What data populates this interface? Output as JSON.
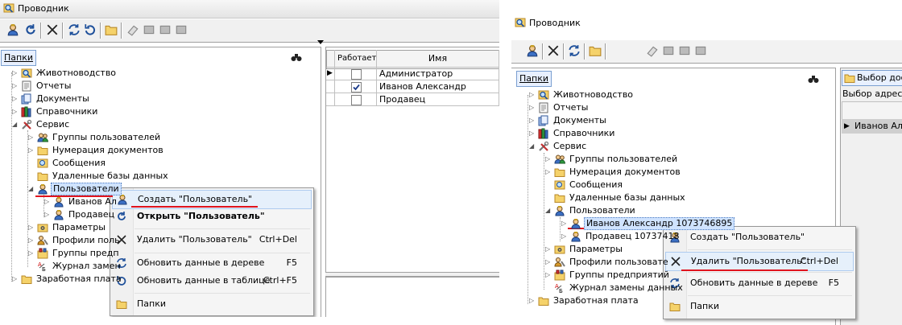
{
  "left_window": {
    "title": "Проводник",
    "folders_tab": "Папки",
    "tree": [
      {
        "label": "Животноводство",
        "icon": "search-folder-icon"
      },
      {
        "label": "Отчеты",
        "icon": "report-icon"
      },
      {
        "label": "Документы",
        "icon": "documents-icon"
      },
      {
        "label": "Справочники",
        "icon": "books-icon"
      },
      {
        "label": "Сервис",
        "icon": "tools-icon"
      },
      {
        "label": "Группы пользователей",
        "icon": "user-group-icon"
      },
      {
        "label": "Нумерация документов",
        "icon": "folder-icon"
      },
      {
        "label": "Сообщения",
        "icon": "messages-icon"
      },
      {
        "label": "Удаленные базы данных",
        "icon": "folder-icon"
      },
      {
        "label": "Пользователи",
        "icon": "users-icon"
      },
      {
        "label": "Иванов Ал",
        "icon": "user-icon"
      },
      {
        "label": "Продавец",
        "icon": "user-icon"
      },
      {
        "label": "Параметры",
        "icon": "params-icon"
      },
      {
        "label": "Профили поль",
        "icon": "profiles-icon"
      },
      {
        "label": "Группы предп",
        "icon": "enterprise-group-icon"
      },
      {
        "label": "Журнал замен",
        "icon": "journal-icon"
      },
      {
        "label": "Заработная плата",
        "icon": "folder-icon"
      }
    ],
    "grid": {
      "columns": [
        "Работает",
        "Имя"
      ],
      "rows": [
        {
          "works": false,
          "name": "Администратор"
        },
        {
          "works": true,
          "name": "Иванов Александр"
        },
        {
          "works": false,
          "name": "Продавец"
        }
      ]
    },
    "menu": [
      {
        "label": "Создать \"Пользователь\"",
        "shortcut": "",
        "icon": "user-create-icon"
      },
      {
        "label": "Открыть \"Пользователь\"",
        "shortcut": "",
        "icon": "refresh-open-icon"
      },
      {
        "label": "Удалить \"Пользователь\"",
        "shortcut": "Ctrl+Del",
        "icon": "delete-x-icon"
      },
      {
        "label": "Обновить данные в дереве",
        "shortcut": "F5",
        "icon": "refresh-tree-icon"
      },
      {
        "label": "Обновить данные в таблице",
        "shortcut": "Ctrl+F5",
        "icon": "refresh-table-icon"
      },
      {
        "label": "Папки",
        "shortcut": "",
        "icon": "folder-icon"
      }
    ]
  },
  "right_window": {
    "title": "Проводник",
    "folders_tab": "Папки",
    "right_tab": "Выбор дост",
    "right_label": "Выбор адреса",
    "right_row": "Иванов Але",
    "tree": [
      {
        "label": "Животноводство",
        "icon": "search-folder-icon"
      },
      {
        "label": "Отчеты",
        "icon": "report-icon"
      },
      {
        "label": "Документы",
        "icon": "documents-icon"
      },
      {
        "label": "Справочники",
        "icon": "books-icon"
      },
      {
        "label": "Сервис",
        "icon": "tools-icon"
      },
      {
        "label": "Группы пользователей",
        "icon": "user-group-icon"
      },
      {
        "label": "Нумерация документов",
        "icon": "folder-icon"
      },
      {
        "label": "Сообщения",
        "icon": "messages-icon"
      },
      {
        "label": "Удаленные базы данных",
        "icon": "folder-icon"
      },
      {
        "label": "Пользователи",
        "icon": "users-icon"
      },
      {
        "label": "Иванов Александр 1073746895",
        "icon": "user-icon"
      },
      {
        "label": "Продавец 10737418",
        "icon": "user-icon"
      },
      {
        "label": "Параметры",
        "icon": "params-icon"
      },
      {
        "label": "Профили пользовате",
        "icon": "profiles-icon"
      },
      {
        "label": "Группы предприятий",
        "icon": "enterprise-group-icon"
      },
      {
        "label": "Журнал замены данных",
        "icon": "journal-icon"
      },
      {
        "label": "Заработная плата",
        "icon": "folder-icon"
      }
    ],
    "menu": [
      {
        "label": "Создать \"Пользователь\"",
        "shortcut": "",
        "icon": "user-create-icon"
      },
      {
        "label": "Удалить \"Пользователь\"",
        "shortcut": "Ctrl+Del",
        "icon": "delete-x-icon"
      },
      {
        "label": "Обновить данные в дереве",
        "shortcut": "F5",
        "icon": "refresh-tree-icon"
      },
      {
        "label": "Папки",
        "shortcut": "",
        "icon": "folder-icon"
      }
    ]
  },
  "colors": {
    "highlight": "#e6f0fb",
    "underline": "#e0141e",
    "selection": "#cfe3ff"
  }
}
